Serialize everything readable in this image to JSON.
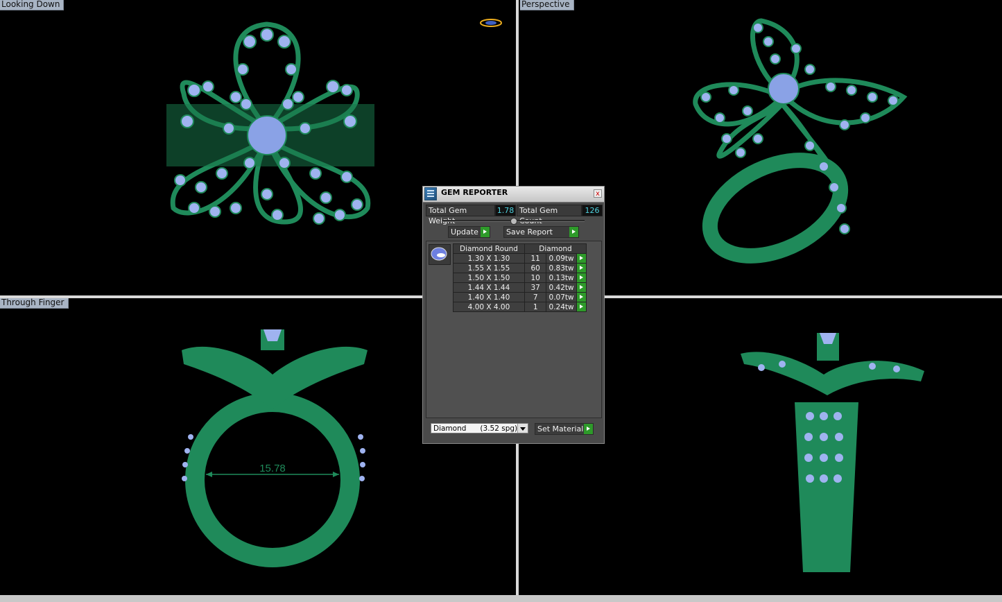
{
  "viewports": {
    "top_left": {
      "label": "Looking Down"
    },
    "top_right": {
      "label": "Perspective"
    },
    "bottom_left": {
      "label": "Through Finger",
      "dimension": "15.78"
    },
    "bottom_right": {
      "label": ""
    }
  },
  "gem_reporter": {
    "title": "GEM REPORTER",
    "close": "x",
    "total_weight_label": "Total Gem Weight",
    "total_weight_value": "1.78",
    "total_count_label": "Total Gem Count",
    "total_count_value": "126",
    "update_label": "Update",
    "save_report_label": "Save Report",
    "table": {
      "headers": [
        "Diamond Round",
        "Diamond"
      ],
      "rows": [
        {
          "size": "1.30 X 1.30",
          "count": "11",
          "weight": "0.09tw"
        },
        {
          "size": "1.55 X 1.55",
          "count": "60",
          "weight": "0.83tw"
        },
        {
          "size": "1.50 X 1.50",
          "count": "10",
          "weight": "0.13tw"
        },
        {
          "size": "1.44 X 1.44",
          "count": "37",
          "weight": "0.42tw"
        },
        {
          "size": "1.40 X 1.40",
          "count": "7",
          "weight": "0.07tw"
        },
        {
          "size": "4.00 X 4.00",
          "count": "1",
          "weight": "0.24tw"
        }
      ]
    },
    "material_select": "Diamond      (3.52 spg)",
    "set_material_label": "Set Material"
  },
  "colors": {
    "metal": "#1f8a5a",
    "gem": "#9fb3f0",
    "background": "#000000"
  }
}
